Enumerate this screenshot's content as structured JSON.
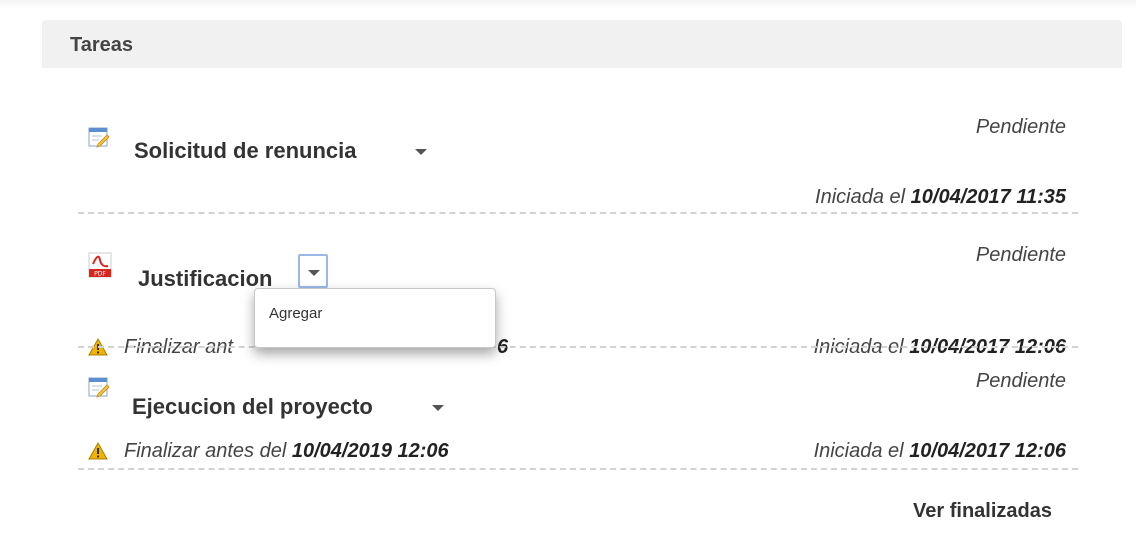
{
  "panel": {
    "title": "Tareas"
  },
  "tasks": [
    {
      "name": "Solicitud de renuncia",
      "icon": "form-edit-icon",
      "status": "Pendiente",
      "started_prefix": "Iniciada el ",
      "started_date": "10/04/2017 11:35"
    },
    {
      "name": "Justificacion",
      "icon": "pdf-icon",
      "status": "Pendiente",
      "deadline_prefix": "Finalizar ant",
      "deadline_tail": "6",
      "started_prefix": "Iniciada el ",
      "started_date": "10/04/2017 12:06"
    },
    {
      "name": "Ejecucion del proyecto",
      "icon": "form-edit-icon",
      "status": "Pendiente",
      "deadline_prefix": "Finalizar antes del ",
      "deadline_date": "10/04/2019 12:06",
      "started_prefix": "Iniciada el ",
      "started_date": "10/04/2017 12:06"
    }
  ],
  "dropdown": {
    "items": [
      "Agregar"
    ]
  },
  "footer": {
    "link": "Ver finalizadas"
  },
  "colors": {
    "header_bg": "#f1f1f1",
    "dropdown_border_focus": "#9ab8e6",
    "warning": "#f0b400",
    "pdf_red": "#d9261c"
  }
}
